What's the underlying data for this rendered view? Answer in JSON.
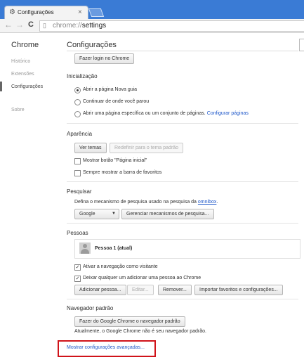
{
  "browser": {
    "tab_title": "Configurações",
    "tab_icon": "gear-icon",
    "url_scheme": "chrome://",
    "url_path": "settings"
  },
  "sidebar": {
    "title": "Chrome",
    "items": [
      {
        "label": "Histórico"
      },
      {
        "label": "Extensões"
      },
      {
        "label": "Configurações",
        "active": true
      },
      {
        "label": "Sobre"
      }
    ]
  },
  "main": {
    "title": "Configurações",
    "signin_button": "Fazer login no Chrome",
    "startup": {
      "heading": "Inicialização",
      "options": [
        {
          "label": "Abrir a página Nova guia",
          "selected": true
        },
        {
          "label": "Continuar de onde você parou",
          "selected": false
        },
        {
          "label": "Abrir uma página específica ou um conjunto de páginas.",
          "selected": false,
          "link": "Configurar páginas"
        }
      ]
    },
    "appearance": {
      "heading": "Aparência",
      "themes_button": "Ver temas",
      "reset_theme_button": "Redefinir para o tema padrão",
      "show_home": "Mostrar botão \"Página inicial\"",
      "show_bookmarks": "Sempre mostrar a barra de favoritos"
    },
    "search": {
      "heading": "Pesquisar",
      "description_prefix": "Defina o mecanismo de pesquisa usado na pesquisa da",
      "omnibox_link": "omnibox",
      "description_suffix": ".",
      "engine_value": "Google",
      "manage_button": "Gerenciar mecanismos de pesquisa..."
    },
    "people": {
      "heading": "Pessoas",
      "profile_name": "Pessoa 1 (atual)",
      "guest_checkbox": "Ativar a navegação como visitante",
      "guest_checked": true,
      "add_anyone_checkbox": "Deixar qualquer um adicionar uma pessoa ao Chrome",
      "add_anyone_checked": true,
      "add_button": "Adicionar pessoa...",
      "edit_button": "Editar...",
      "remove_button": "Remover...",
      "import_button": "Importar favoritos e configurações..."
    },
    "default_browser": {
      "heading": "Navegador padrão",
      "make_default_button": "Fazer do Google Chrome o navegador padrão",
      "status": "Atualmente, o Google Chrome não é seu navegador padrão."
    },
    "advanced_link": "Mostrar configurações avançadas...",
    "colors": {
      "titlebar": "#3a7bd5",
      "link": "#1c56c9",
      "highlight": "#d0131a"
    }
  }
}
